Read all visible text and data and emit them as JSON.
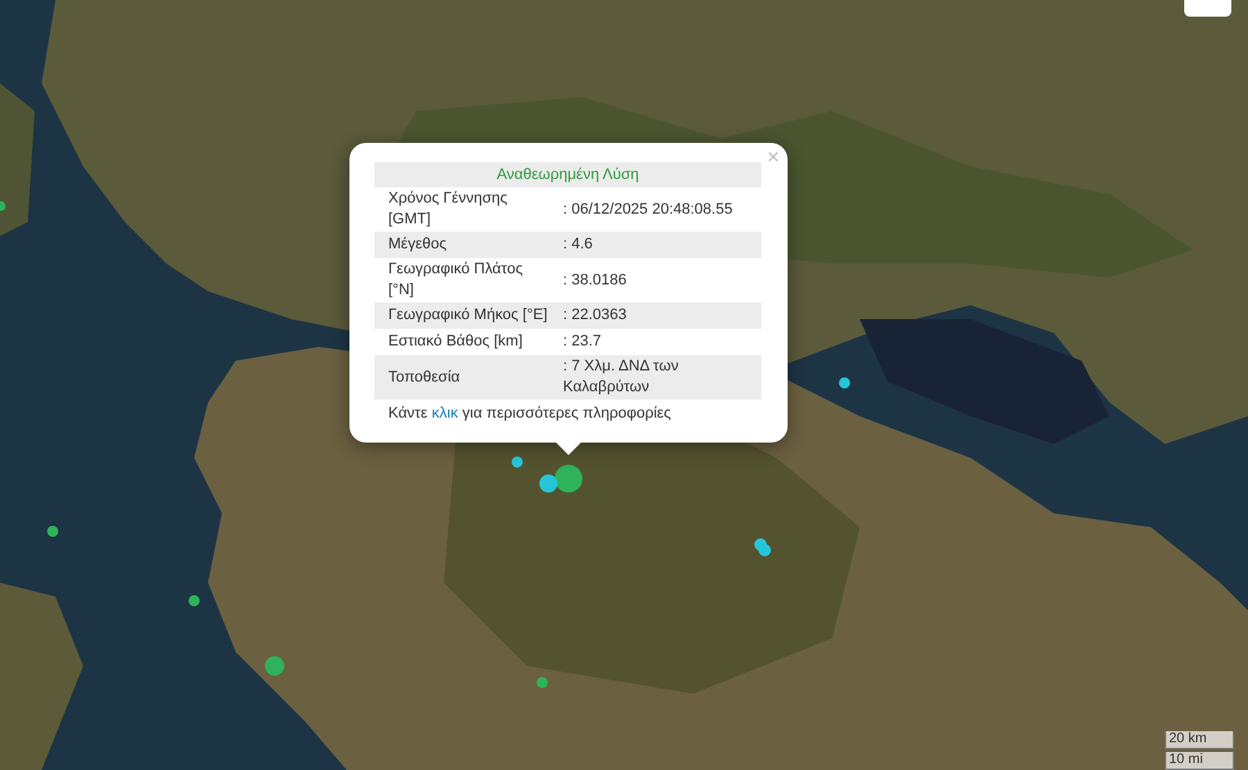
{
  "map": {
    "markers": [
      {
        "color": "#2eb35a"
      },
      {
        "color": "#2eb35a"
      },
      {
        "color": "#2eb35a"
      },
      {
        "color": "#2eb35a"
      },
      {
        "color": "#2eb35a"
      },
      {
        "color": "#2eb35a"
      },
      {
        "color": "#26c6da"
      },
      {
        "color": "#26c6da"
      },
      {
        "color": "#26c6da"
      },
      {
        "color": "#26c6da"
      },
      {
        "color": "#26c6da"
      }
    ]
  },
  "popup": {
    "close": "×",
    "title": "Αναθεωρημένη Λύση",
    "rows": [
      {
        "label": "Χρόνος Γέννησης [GMT]",
        "value": ": 06/12/2025 20:48:08.55"
      },
      {
        "label": "Μέγεθος",
        "value": ": 4.6"
      },
      {
        "label": "Γεωγραφικό Πλάτος [°N]",
        "value": ": 38.0186"
      },
      {
        "label": "Γεωγραφικό Μήκος [°E]",
        "value": ": 22.0363"
      },
      {
        "label": "Εστιακό Βάθος [km]",
        "value": ": 23.7"
      },
      {
        "label": "Τοποθεσία",
        "value": ": 7 Χλμ. ΔΝΔ των Καλαβρύτων"
      }
    ],
    "footer_before": "Κάντε",
    "footer_link": "κλικ",
    "footer_after": "για περισσότερες πληροφορίες"
  },
  "scale": {
    "metric": "20 km",
    "imperial": "10 mi"
  }
}
